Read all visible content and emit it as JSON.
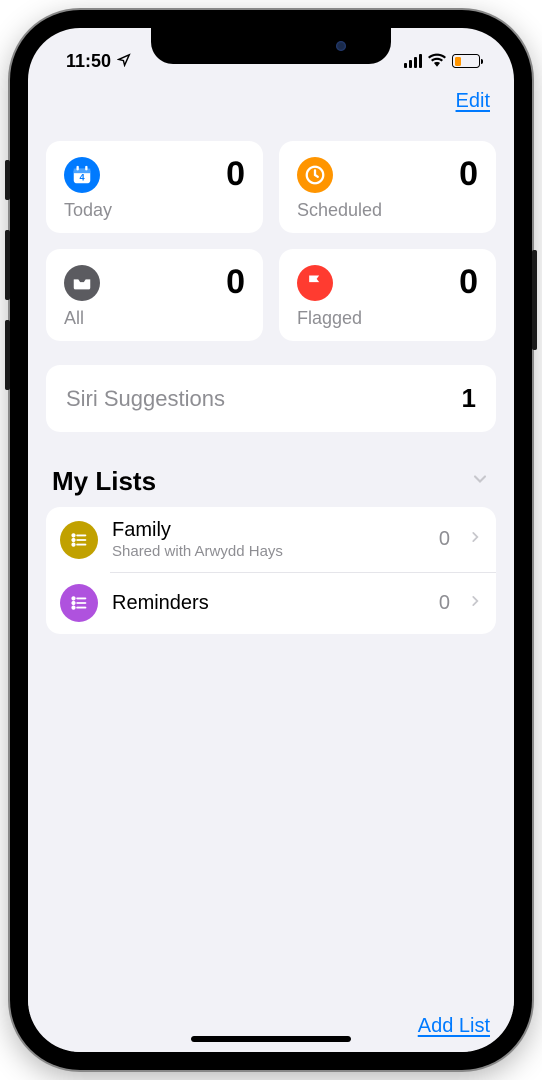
{
  "status": {
    "time": "11:50"
  },
  "nav": {
    "edit": "Edit"
  },
  "cards": {
    "today": {
      "label": "Today",
      "count": "0"
    },
    "scheduled": {
      "label": "Scheduled",
      "count": "0"
    },
    "all": {
      "label": "All",
      "count": "0"
    },
    "flagged": {
      "label": "Flagged",
      "count": "0"
    }
  },
  "siri": {
    "label": "Siri Suggestions",
    "count": "1"
  },
  "section": {
    "title": "My Lists"
  },
  "lists": {
    "family": {
      "name": "Family",
      "subtitle": "Shared with Arwydd Hays",
      "count": "0"
    },
    "reminders": {
      "name": "Reminders",
      "count": "0"
    }
  },
  "footer": {
    "add_list": "Add List"
  }
}
